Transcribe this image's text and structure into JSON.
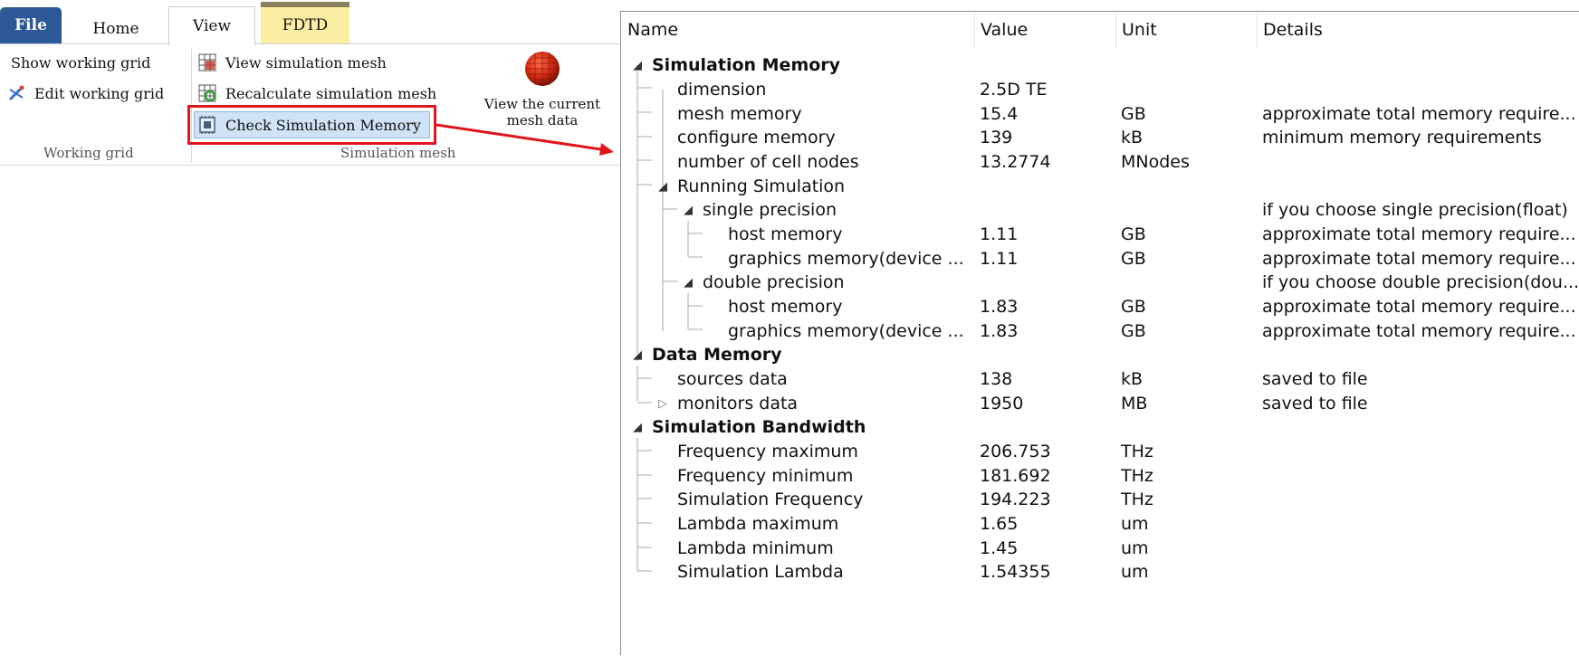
{
  "ribbon": {
    "tabs": [
      {
        "label": "File"
      },
      {
        "label": "Home"
      },
      {
        "label": "View"
      },
      {
        "label": "FDTD"
      }
    ],
    "working_grid": {
      "show": "Show working grid",
      "edit": "Edit working grid",
      "group_label": "Working grid"
    },
    "simulation_mesh": {
      "view": "View simulation mesh",
      "recalculate": "Recalculate simulation mesh",
      "check_memory": "Check Simulation Memory",
      "current_line1": "View the current",
      "current_line2": "mesh data",
      "group_label": "Simulation mesh"
    },
    "colors": {
      "file_tab": "#2c5898",
      "fdtd_tab": "#fbeea3",
      "highlight": "#e0151b"
    }
  },
  "table": {
    "headers": {
      "name": "Name",
      "value": "Value",
      "unit": "Unit",
      "details": "Details"
    },
    "rows": [
      {
        "name": "Simulation Memory",
        "value": "",
        "unit": "",
        "details": ""
      },
      {
        "name": "dimension",
        "value": "2.5D TE",
        "unit": "",
        "details": ""
      },
      {
        "name": "mesh memory",
        "value": "15.4",
        "unit": "GB",
        "details": "approximate total memory require..."
      },
      {
        "name": "configure memory",
        "value": "139",
        "unit": "kB",
        "details": "minimum memory requirements"
      },
      {
        "name": "number of cell nodes",
        "value": "13.2774",
        "unit": "MNodes",
        "details": ""
      },
      {
        "name": "Running Simulation",
        "value": "",
        "unit": "",
        "details": ""
      },
      {
        "name": "single precision",
        "value": "",
        "unit": "",
        "details": "if you choose single precision(float)"
      },
      {
        "name": "host memory",
        "value": "1.11",
        "unit": "GB",
        "details": "approximate total memory require..."
      },
      {
        "name": "graphics memory(device ...",
        "value": "1.11",
        "unit": "GB",
        "details": "approximate total memory require..."
      },
      {
        "name": "double precision",
        "value": "",
        "unit": "",
        "details": "if you choose double precision(dou..."
      },
      {
        "name": "host memory",
        "value": "1.83",
        "unit": "GB",
        "details": "approximate total memory require..."
      },
      {
        "name": "graphics memory(device ...",
        "value": "1.83",
        "unit": "GB",
        "details": "approximate total memory require..."
      },
      {
        "name": "Data Memory",
        "value": "",
        "unit": "",
        "details": ""
      },
      {
        "name": "sources data",
        "value": "138",
        "unit": "kB",
        "details": "saved to file"
      },
      {
        "name": "monitors data",
        "value": "1950",
        "unit": "MB",
        "details": "saved to file"
      },
      {
        "name": "Simulation Bandwidth",
        "value": "",
        "unit": "",
        "details": ""
      },
      {
        "name": "Frequency maximum",
        "value": "206.753",
        "unit": "THz",
        "details": ""
      },
      {
        "name": "Frequency minimum",
        "value": "181.692",
        "unit": "THz",
        "details": ""
      },
      {
        "name": "Simulation Frequency",
        "value": "194.223",
        "unit": "THz",
        "details": ""
      },
      {
        "name": "Lambda maximum",
        "value": "1.65",
        "unit": "um",
        "details": ""
      },
      {
        "name": "Lambda minimum",
        "value": "1.45",
        "unit": "um",
        "details": ""
      },
      {
        "name": "Simulation Lambda",
        "value": "1.54355",
        "unit": "um",
        "details": ""
      }
    ]
  }
}
